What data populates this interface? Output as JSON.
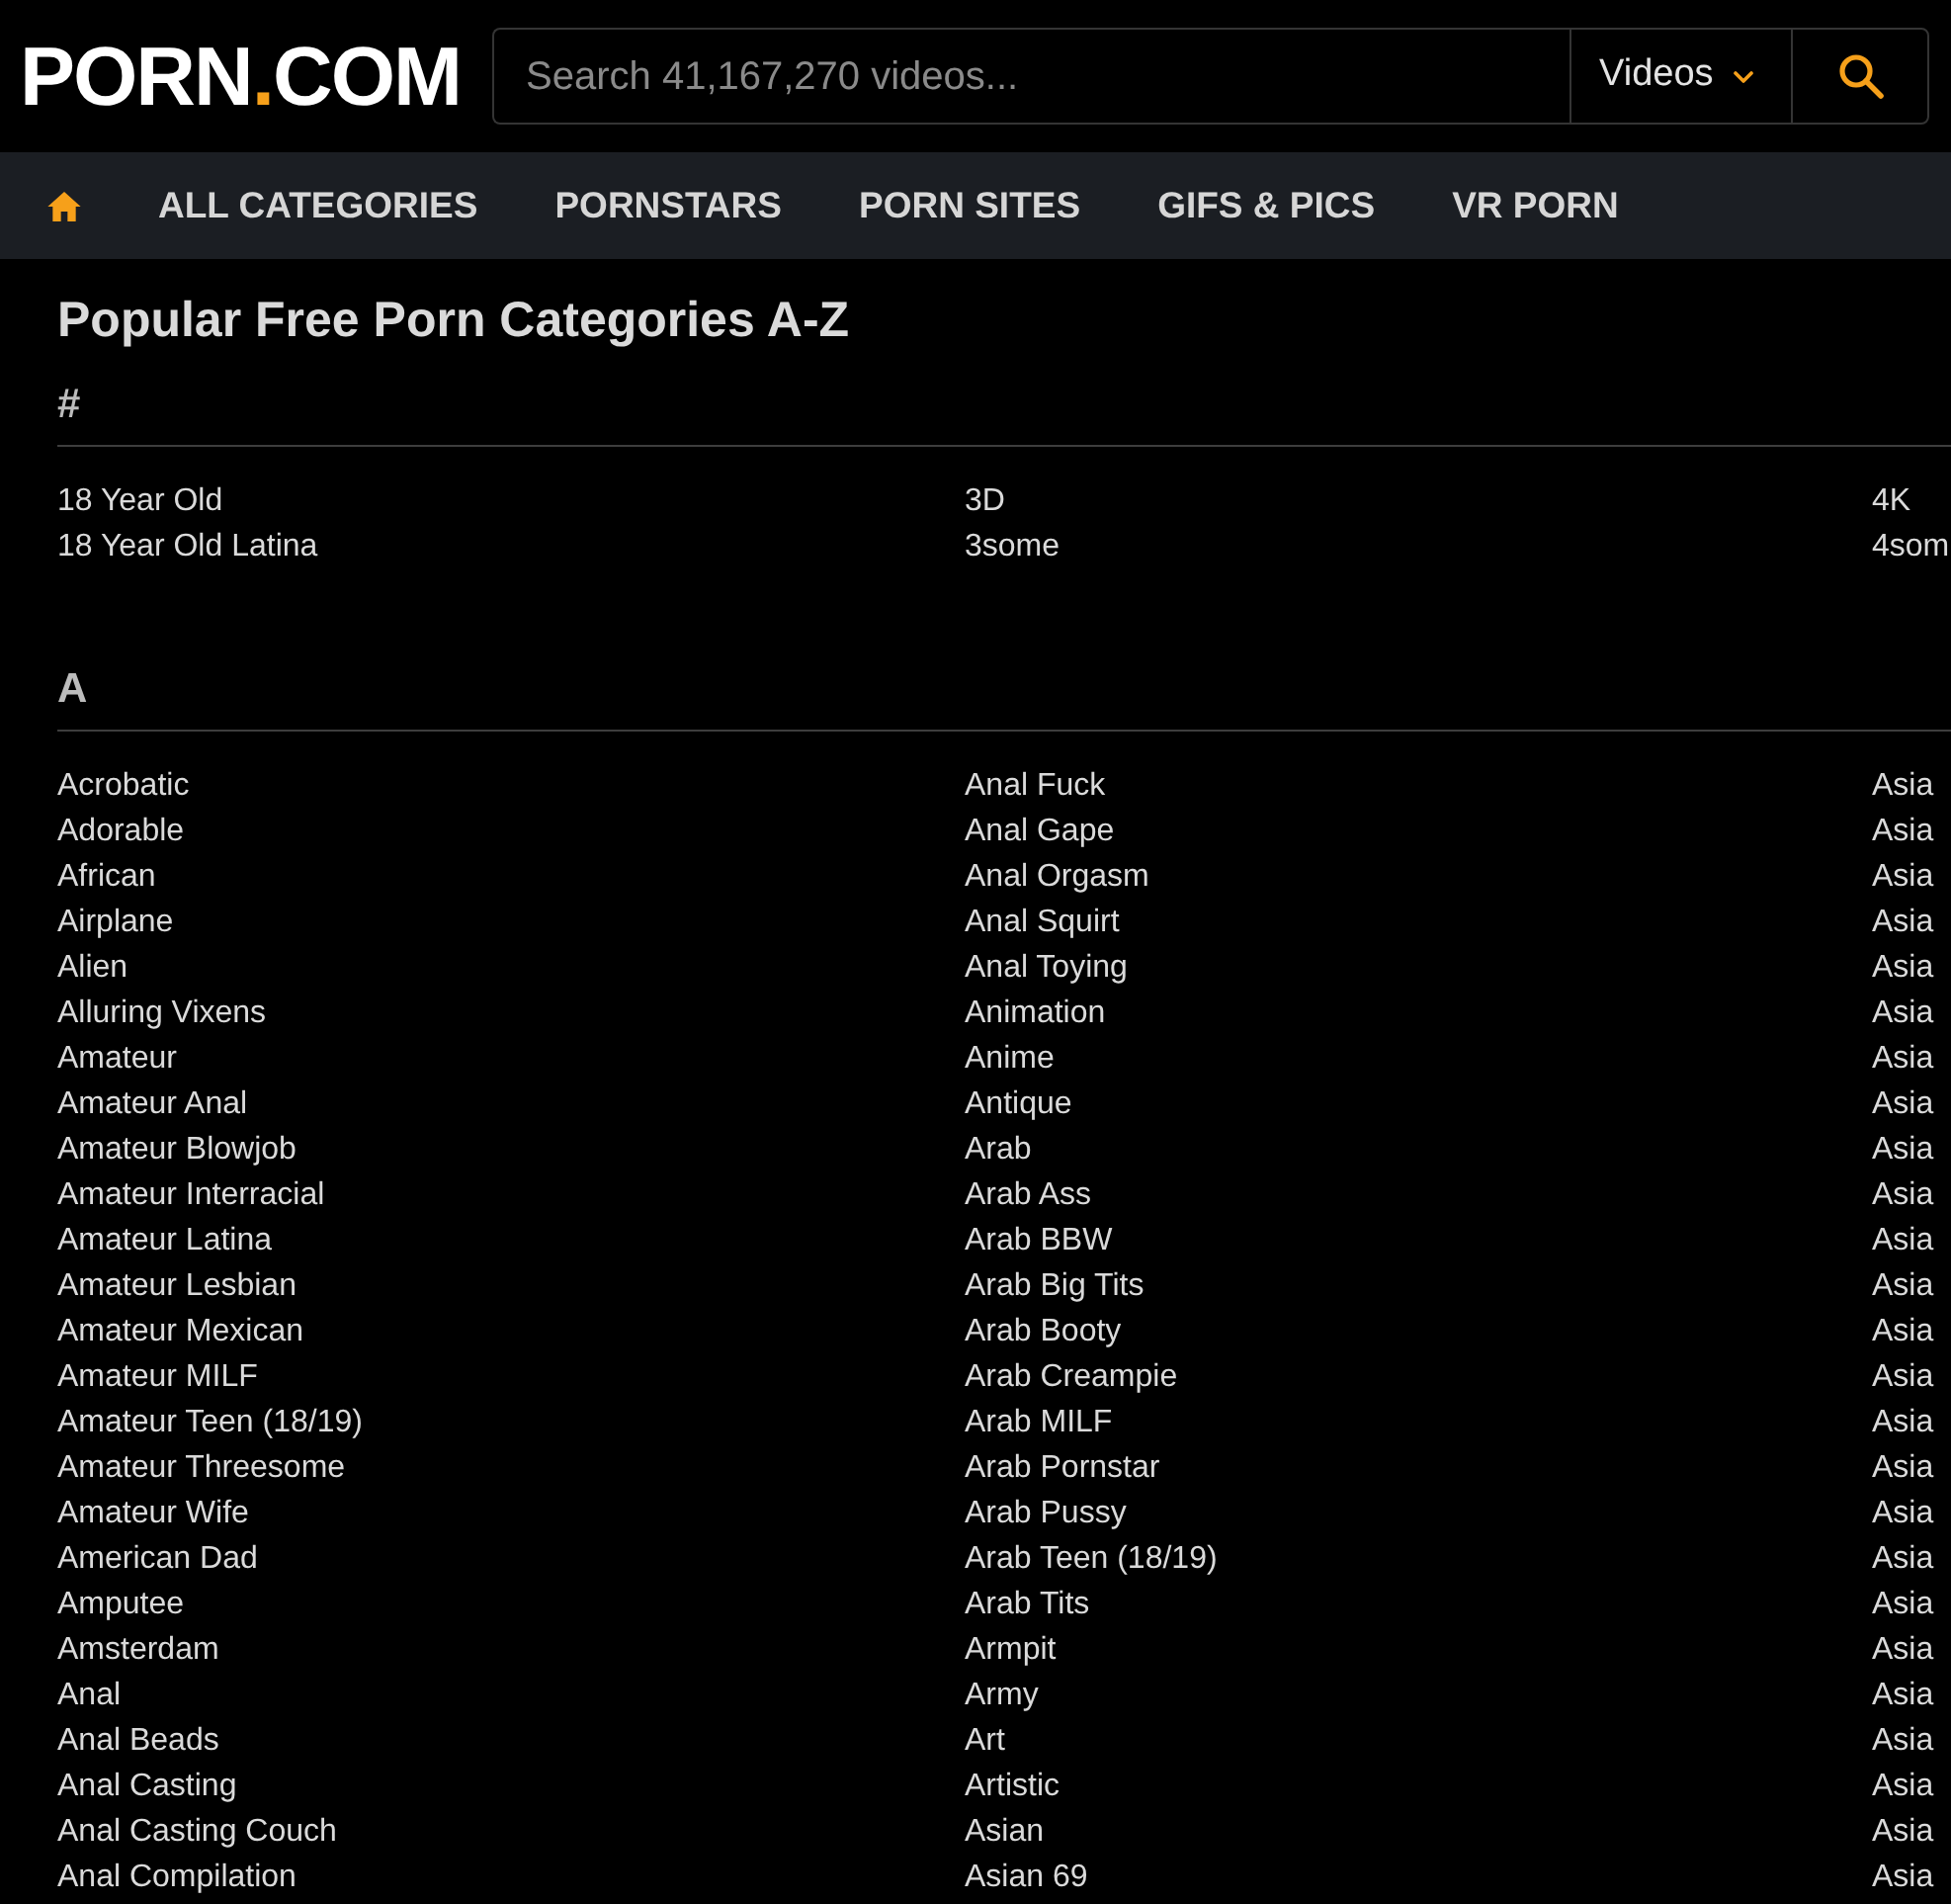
{
  "header": {
    "logo": {
      "name": "PORN",
      "dot": ".",
      "suffix": "COM"
    },
    "search": {
      "placeholder": "Search 41,167,270 videos...",
      "scope": "Videos"
    }
  },
  "nav": {
    "items": [
      "ALL CATEGORIES",
      "PORNSTARS",
      "PORN SITES",
      "GIFS & PICS",
      "VR PORN"
    ]
  },
  "content": {
    "title": "Popular Free Porn Categories A-Z",
    "sections": [
      {
        "heading": "#",
        "columns": [
          [
            "18 Year Old",
            "18 Year Old Latina"
          ],
          [
            "3D",
            "3some"
          ],
          [
            "4K",
            "4som"
          ]
        ]
      },
      {
        "heading": "A",
        "columns": [
          [
            "Acrobatic",
            "Adorable",
            "African",
            "Airplane",
            "Alien",
            "Alluring Vixens",
            "Amateur",
            "Amateur Anal",
            "Amateur Blowjob",
            "Amateur Interracial",
            "Amateur Latina",
            "Amateur Lesbian",
            "Amateur Mexican",
            "Amateur MILF",
            "Amateur Teen (18/19)",
            "Amateur Threesome",
            "Amateur Wife",
            "American Dad",
            "Amputee",
            "Amsterdam",
            "Anal",
            "Anal Beads",
            "Anal Casting",
            "Anal Casting Couch",
            "Anal Compilation"
          ],
          [
            "Anal Fuck",
            "Anal Gape",
            "Anal Orgasm",
            "Anal Squirt",
            "Anal Toying",
            "Animation",
            "Anime",
            "Antique",
            "Arab",
            "Arab Ass",
            "Arab BBW",
            "Arab Big Tits",
            "Arab Booty",
            "Arab Creampie",
            "Arab MILF",
            "Arab Pornstar",
            "Arab Pussy",
            "Arab Teen (18/19)",
            "Arab Tits",
            "Armpit",
            "Army",
            "Art",
            "Artistic",
            "Asian",
            "Asian 69"
          ],
          [
            "Asia",
            "Asia",
            "Asia",
            "Asia",
            "Asia",
            "Asia",
            "Asia",
            "Asia",
            "Asia",
            "Asia",
            "Asia",
            "Asia",
            "Asia",
            "Asia",
            "Asia",
            "Asia",
            "Asia",
            "Asia",
            "Asia",
            "Asia",
            "Asia",
            "Asia",
            "Asia",
            "Asia",
            "Asia"
          ]
        ]
      }
    ]
  }
}
